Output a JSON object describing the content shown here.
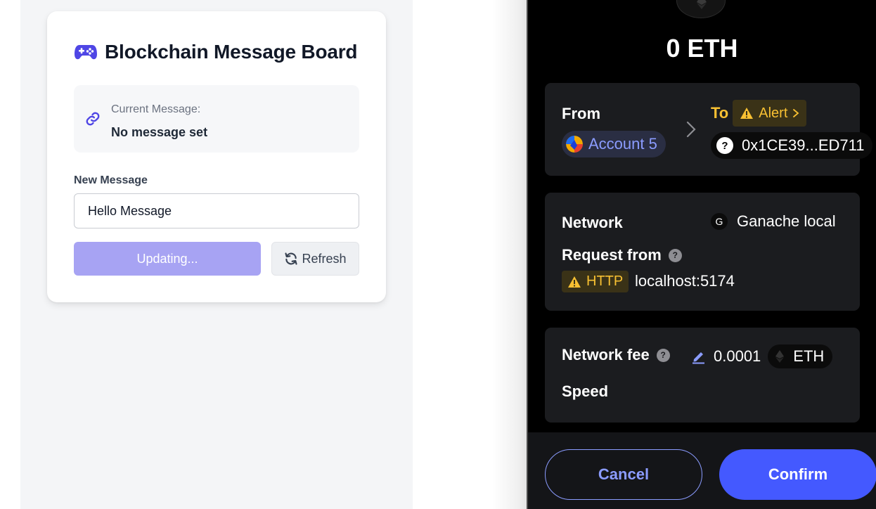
{
  "dapp": {
    "title": "Blockchain Message Board",
    "title_icon": "gamepad-icon",
    "current_message_label": "Current Message:",
    "current_message_value": "No message set",
    "new_message_label": "New Message",
    "new_message_value": "Hello Message",
    "update_button_label": "Updating...",
    "refresh_button_label": "Refresh",
    "colors": {
      "accent": "#4f46e5",
      "button_disabled": "#a7a3f3",
      "background": "#f4f5f7"
    }
  },
  "wallet": {
    "amount": "0 ETH",
    "from_label": "From",
    "account_name": "Account 5",
    "to_label": "To",
    "alert_label": "Alert",
    "to_address": "0x1CE39...ED711",
    "network_label": "Network",
    "network_value": "Ganache local",
    "network_initial": "G",
    "request_from_label": "Request from",
    "protocol_badge": "HTTP",
    "origin": "localhost:5174",
    "fee_label": "Network fee",
    "fee_value": "0.0001",
    "fee_currency": "ETH",
    "speed_label": "Speed",
    "cancel_label": "Cancel",
    "confirm_label": "Confirm",
    "colors": {
      "accent": "#4459ff",
      "link": "#8b9cff",
      "warning": "#f8c032",
      "panel": "#1b1c1f"
    }
  }
}
